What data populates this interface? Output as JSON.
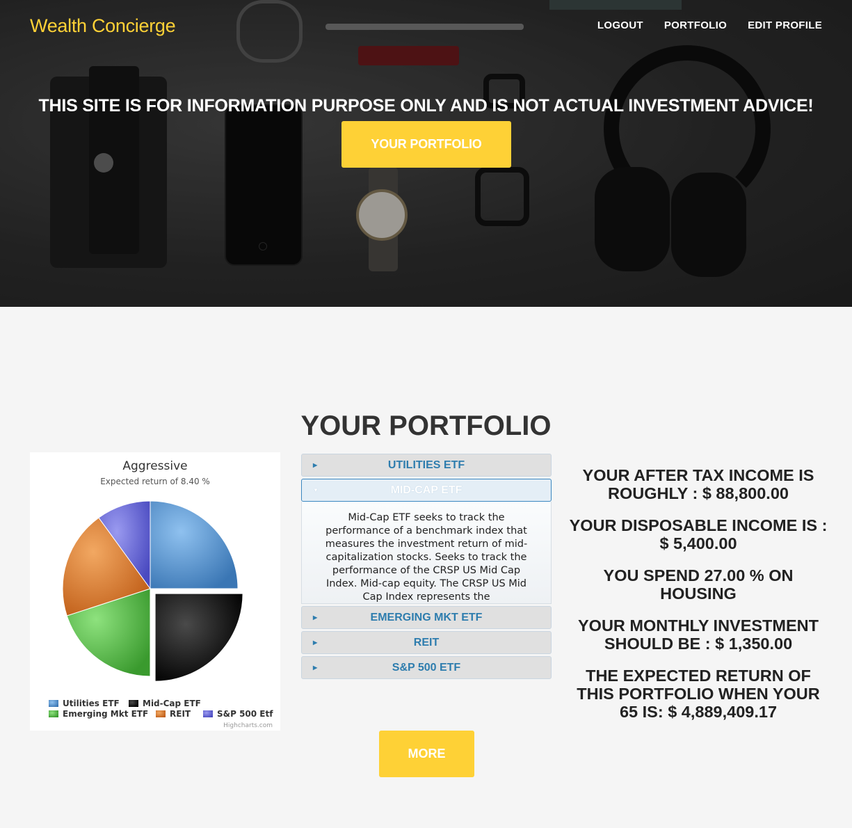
{
  "brand": "Wealth Concierge",
  "nav": [
    "LOGOUT",
    "PORTFOLIO",
    "EDIT PROFILE"
  ],
  "hero": {
    "disclaimer": "THIS SITE IS FOR INFORMATION PURPOSE ONLY AND IS NOT ACTUAL INVESTMENT ADVICE!",
    "button_label": "YOUR PORTFOLIO"
  },
  "portfolio": {
    "heading": "YOUR PORTFOLIO",
    "more_label": "MORE"
  },
  "chart_data": {
    "type": "pie",
    "title": "Aggressive",
    "subtitle": "Expected return of 8.40 %",
    "credit": "Highcharts.com",
    "series": [
      {
        "name": "Utilities ETF",
        "value": 25,
        "color": "#4a8fd6"
      },
      {
        "name": "Mid-Cap ETF",
        "value": 25,
        "color": "#111111",
        "sliced": true
      },
      {
        "name": "Emerging Mkt ETF",
        "value": 20,
        "color": "#56c24a"
      },
      {
        "name": "REIT",
        "value": 20,
        "color": "#e07a2e"
      },
      {
        "name": "S&P 500 Etf",
        "value": 10,
        "color": "#5f5fd6"
      }
    ]
  },
  "accordion": [
    {
      "label": "UTILITIES ETF",
      "active": false
    },
    {
      "label": "MID-CAP ETF",
      "active": true,
      "body": "Mid-Cap ETF seeks to track the performance of a benchmark index that measures the investment return of mid-capitalization stocks. Seeks to track the performance of the CRSP US Mid Cap Index. Mid-cap equity. The CRSP US Mid Cap Index represents the"
    },
    {
      "label": "EMERGING MKT ETF",
      "active": false
    },
    {
      "label": "REIT",
      "active": false
    },
    {
      "label": "S&P 500 ETF",
      "active": false
    }
  ],
  "stats": [
    "YOUR AFTER TAX INCOME IS ROUGHLY : $ 88,800.00",
    "YOUR DISPOSABLE INCOME IS : $ 5,400.00",
    "YOU SPEND 27.00 % ON HOUSING",
    "YOUR MONTHLY INVESTMENT SHOULD BE : $ 1,350.00",
    "THE EXPECTED RETURN OF THIS PORTFOLIO WHEN YOUR 65 IS: $ 4,889,409.17"
  ],
  "colors": {
    "accent": "#fed136",
    "link": "#2e7dae"
  }
}
